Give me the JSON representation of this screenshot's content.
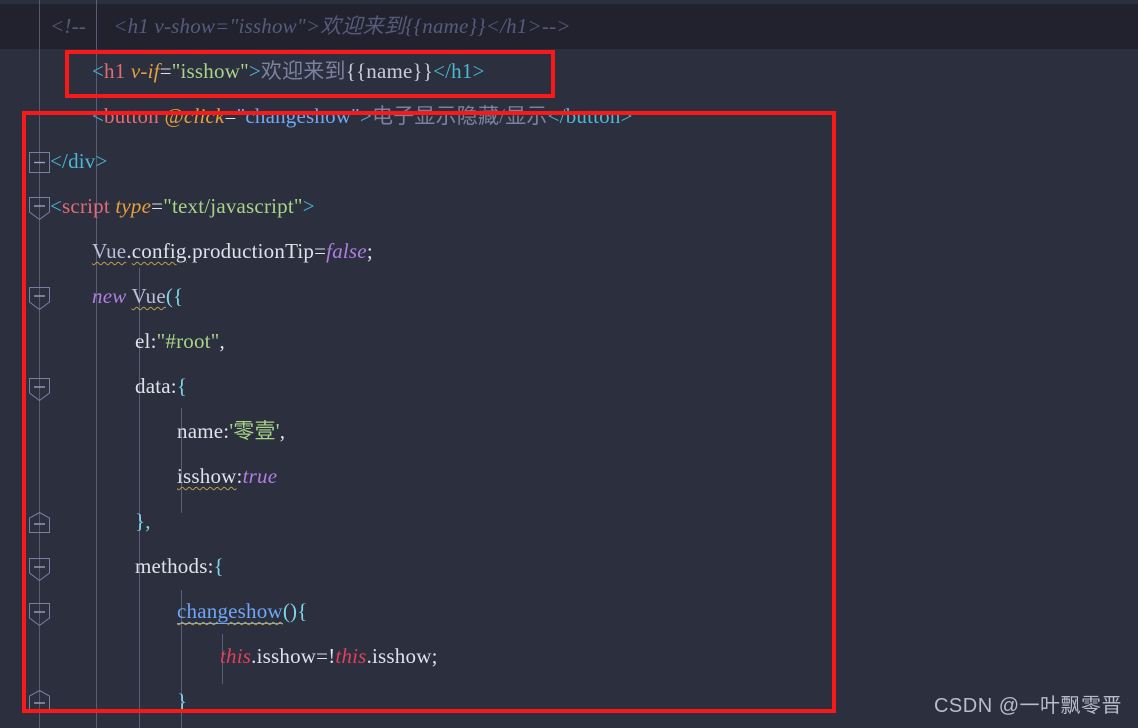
{
  "editor": {
    "theme_background": "#2b2f3e",
    "comment_line_background": "#22222e",
    "annotation_color": "#fb1818",
    "lines": [
      {
        "id": "line-comment",
        "text": "<!--     <h1 v-show=\"isshow\">欢迎来到{{name}}</h1>-->"
      },
      {
        "id": "line-h1",
        "text": "<h1 v-if=\"isshow\">欢迎来到{{name}}</h1>",
        "tokens": {
          "open": "<",
          "tag": "h1",
          "attr": "v-if",
          "equals": "=",
          "value": "\"isshow\"",
          "close": ">",
          "chinese": "欢迎来到",
          "mustache": "{{name}}",
          "endtag": "</h1>"
        }
      },
      {
        "id": "line-button",
        "text": "<button @click=\"changeshow\">电子显示隐藏/显示</button>",
        "tokens": {
          "open": "<",
          "tag": "button",
          "attr": "@click",
          "equals": "=",
          "value": "\"changeshow\"",
          "close": ">",
          "chinese": "电子显示隐藏/显示",
          "endtag": "</button>"
        }
      },
      {
        "id": "line-div-close",
        "text": "</div>"
      },
      {
        "id": "line-script-open",
        "text": "<script type=\"text/javascript\">",
        "tokens": {
          "open": "<",
          "tag": "script",
          "attr": "type",
          "equals": "=",
          "value": "\"text/javascript\"",
          "close": ">"
        }
      },
      {
        "id": "line-production-tip",
        "text": "Vue.config.productionTip=false;",
        "tokens": {
          "obj": "Vue",
          "dot1": ".",
          "prop1": "config",
          "dot2": ".",
          "prop2": "productionTip",
          "equals": "=",
          "value": "false",
          "semi": ";"
        }
      },
      {
        "id": "line-new-vue",
        "text": "new Vue({",
        "tokens": {
          "keyword": "new",
          "ctor": "Vue",
          "paren": "({"
        }
      },
      {
        "id": "line-el",
        "text": "el:\"#root\",",
        "tokens": {
          "key": "el",
          "colon": ":",
          "value": "\"#root\"",
          "comma": ","
        }
      },
      {
        "id": "line-data",
        "text": "data:{",
        "tokens": {
          "key": "data",
          "colon": ":",
          "brace": "{"
        }
      },
      {
        "id": "line-name",
        "text": "name:'零壹',",
        "tokens": {
          "key": "name",
          "colon": ":",
          "value": "'零壹'",
          "comma": ","
        }
      },
      {
        "id": "line-isshow",
        "text": "isshow:true",
        "tokens": {
          "key": "isshow",
          "colon": ":",
          "value": "true"
        }
      },
      {
        "id": "line-data-close",
        "text": "},"
      },
      {
        "id": "line-methods",
        "text": "methods:{",
        "tokens": {
          "key": "methods",
          "colon": ":",
          "brace": "{"
        }
      },
      {
        "id": "line-changeshow",
        "text": "changeshow(){",
        "tokens": {
          "name": "changeshow",
          "parens": "()",
          "brace": "{"
        }
      },
      {
        "id": "line-toggle",
        "text": "this.isshow=!this.isshow;",
        "tokens": {
          "this1": "this",
          "prop1": ".isshow",
          "equals": "=",
          "bang": "!",
          "this2": "this",
          "prop2": ".isshow",
          "semi": ";"
        }
      },
      {
        "id": "line-method-close",
        "text": "}"
      }
    ],
    "fold_markers": [
      {
        "id": "fold-div-close",
        "state": "collapsed-square"
      },
      {
        "id": "fold-script-open",
        "state": "expanded-pointer"
      },
      {
        "id": "fold-new-vue",
        "state": "expanded-pointer"
      },
      {
        "id": "fold-data",
        "state": "expanded-pointer"
      },
      {
        "id": "fold-data-close",
        "state": "collapsed-square"
      },
      {
        "id": "fold-methods",
        "state": "expanded-pointer"
      },
      {
        "id": "fold-changeshow",
        "state": "expanded-pointer"
      },
      {
        "id": "fold-method-close",
        "state": "collapsed-square"
      }
    ]
  },
  "annotations": {
    "box_h1_label": "highlight around v-if h1 line",
    "box_code_label": "highlight around vue script block"
  },
  "watermark": {
    "text": "CSDN @一叶飘零晋"
  }
}
